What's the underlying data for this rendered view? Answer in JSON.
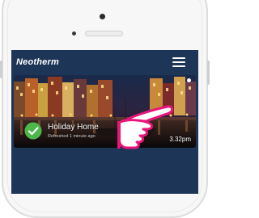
{
  "app": {
    "title": "Neotherm",
    "menu_icon": "hamburger-menu-icon"
  },
  "home_card": {
    "name": "Holiday Home",
    "status": "Refreshed 1 minute ago",
    "time": "3.32pm",
    "status_icon": "check-circle-icon"
  },
  "overlay": {
    "pointer_icon": "pointing-hand-icon"
  },
  "colors": {
    "app_background": "#1d3557",
    "pointer": "#e8157b",
    "check": "#4cb84c"
  }
}
